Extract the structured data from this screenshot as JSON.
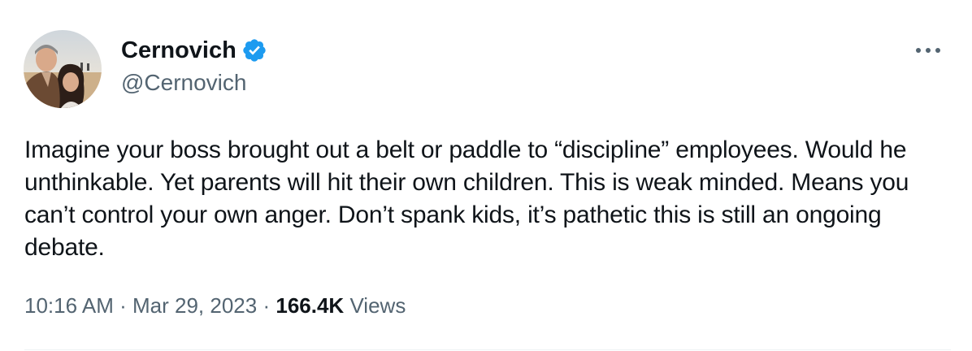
{
  "author": {
    "display_name": "Cernovich",
    "handle": "@Cernovich",
    "verified": true,
    "verified_color": "#1d9bf0"
  },
  "tweet": {
    "text": "Imagine your boss brought out a belt or paddle to “discipline” employees. Would he unthinkable. Yet parents will hit their own children. This is weak minded. Means you can’t control your own anger. Don’t spank kids, it’s pathetic this is still an ongoing debate.",
    "time": "10:16 AM",
    "separator": "·",
    "date": "Mar 29, 2023",
    "views_count": "166.4K",
    "views_label": "Views"
  },
  "icons": {
    "more": "more-horizontal-icon",
    "verified": "verified-badge-icon"
  },
  "colors": {
    "text_primary": "#0f1419",
    "text_secondary": "#536471",
    "accent": "#1d9bf0"
  }
}
